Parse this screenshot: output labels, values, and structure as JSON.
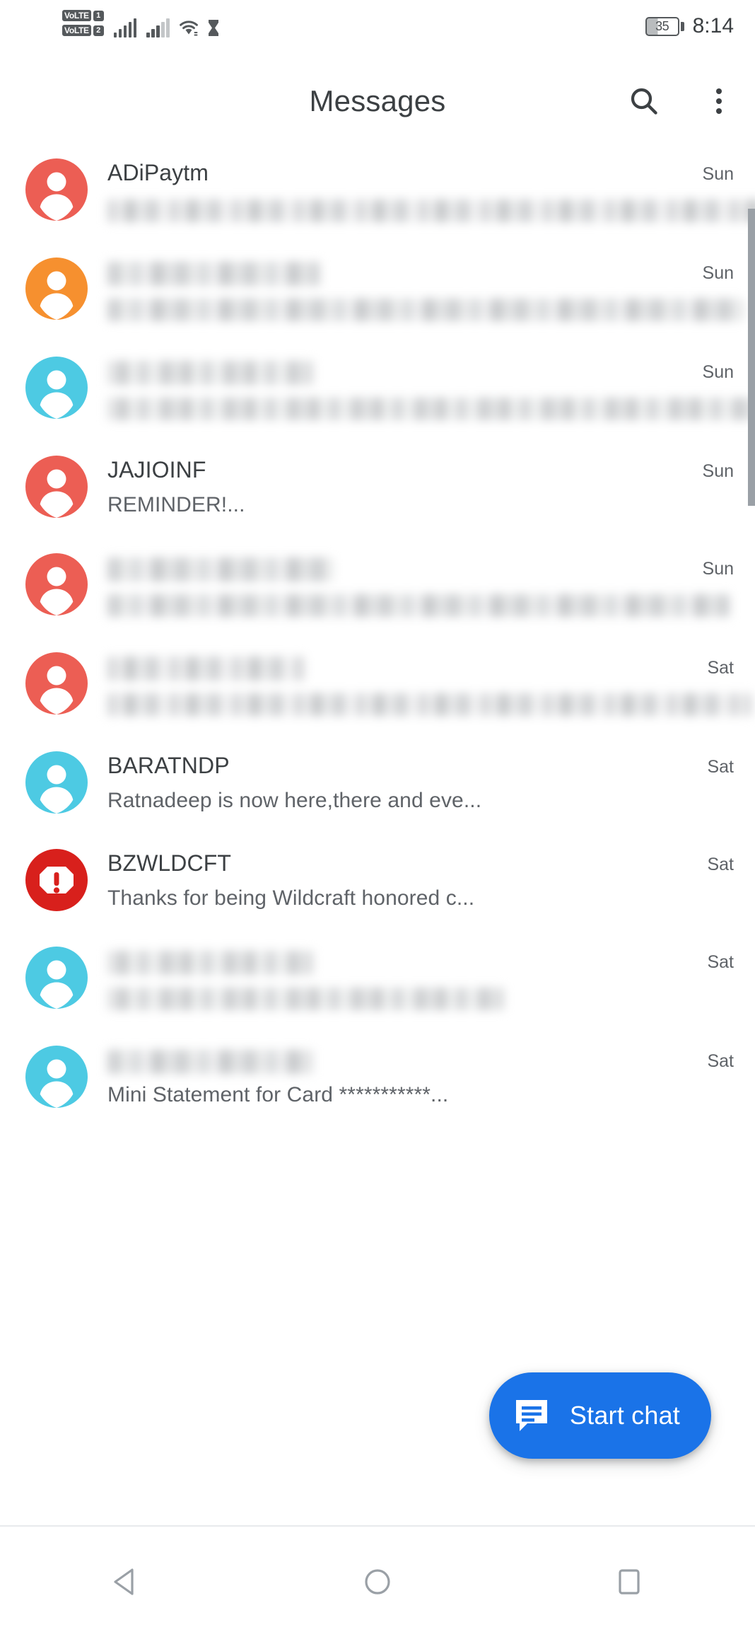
{
  "status_bar": {
    "volte1_label": "VoLTE",
    "volte1_sim": "1",
    "volte2_label": "VoLTE",
    "volte2_sim": "2",
    "signal1": "signal-bars-full-icon",
    "signal2": "signal-bars-partial-icon",
    "wifi": "wifi-icon",
    "alarm": "hourglass-icon",
    "battery_level": "35",
    "time": "8:14"
  },
  "header": {
    "title": "Messages",
    "search_icon": "search-icon",
    "overflow_icon": "more-vert-icon"
  },
  "colors": {
    "avatar_red": "#EC5E54",
    "avatar_orange": "#F6902F",
    "avatar_cyan": "#4DCAE3",
    "avatar_alert_red": "#D8201C",
    "fab_blue": "#1A73E8",
    "text_primary": "#3C4043",
    "text_secondary": "#5F6368"
  },
  "conversations": [
    {
      "name": "ADiPaytm",
      "preview": "",
      "time": "Sun",
      "avatar_color": "#EC5E54",
      "avatar_type": "person",
      "name_redacted": false,
      "preview_redacted": true
    },
    {
      "name": "",
      "preview": "",
      "time": "Sun",
      "avatar_color": "#F6902F",
      "avatar_type": "person",
      "name_redacted": true,
      "preview_redacted": true
    },
    {
      "name": "",
      "preview": "",
      "time": "Sun",
      "avatar_color": "#4DCAE3",
      "avatar_type": "person",
      "name_redacted": true,
      "preview_redacted": true
    },
    {
      "name": "JAJIOINF",
      "preview": "REMINDER!...",
      "time": "Sun",
      "avatar_color": "#EC5E54",
      "avatar_type": "person",
      "name_redacted": false,
      "preview_redacted": false
    },
    {
      "name": "",
      "preview": "",
      "time": "Sun",
      "avatar_color": "#EC5E54",
      "avatar_type": "person",
      "name_redacted": true,
      "preview_redacted": true
    },
    {
      "name": "",
      "preview": "",
      "time": "Sat",
      "avatar_color": "#EC5E54",
      "avatar_type": "person",
      "name_redacted": true,
      "preview_redacted": true
    },
    {
      "name": "BARATNDP",
      "preview": "Ratnadeep is now here,there and eve...",
      "time": "Sat",
      "avatar_color": "#4DCAE3",
      "avatar_type": "person",
      "name_redacted": false,
      "preview_redacted": false
    },
    {
      "name": "BZWLDCFT",
      "preview": "Thanks for being Wildcraft honored c...",
      "time": "Sat",
      "avatar_color": "#D8201C",
      "avatar_type": "alert",
      "name_redacted": false,
      "preview_redacted": false
    },
    {
      "name": "",
      "preview": "",
      "time": "Sat",
      "avatar_color": "#4DCAE3",
      "avatar_type": "person",
      "name_redacted": true,
      "preview_redacted": true
    },
    {
      "name": "",
      "preview": "Mini Statement for Card ***********...",
      "time": "Sat",
      "avatar_color": "#4DCAE3",
      "avatar_type": "person",
      "name_redacted": true,
      "preview_redacted": false
    }
  ],
  "fab": {
    "label": "Start chat",
    "icon": "chat-bubble-icon"
  },
  "nav_bar": {
    "back": "back-triangle-icon",
    "home": "home-circle-icon",
    "recents": "recents-square-icon"
  }
}
